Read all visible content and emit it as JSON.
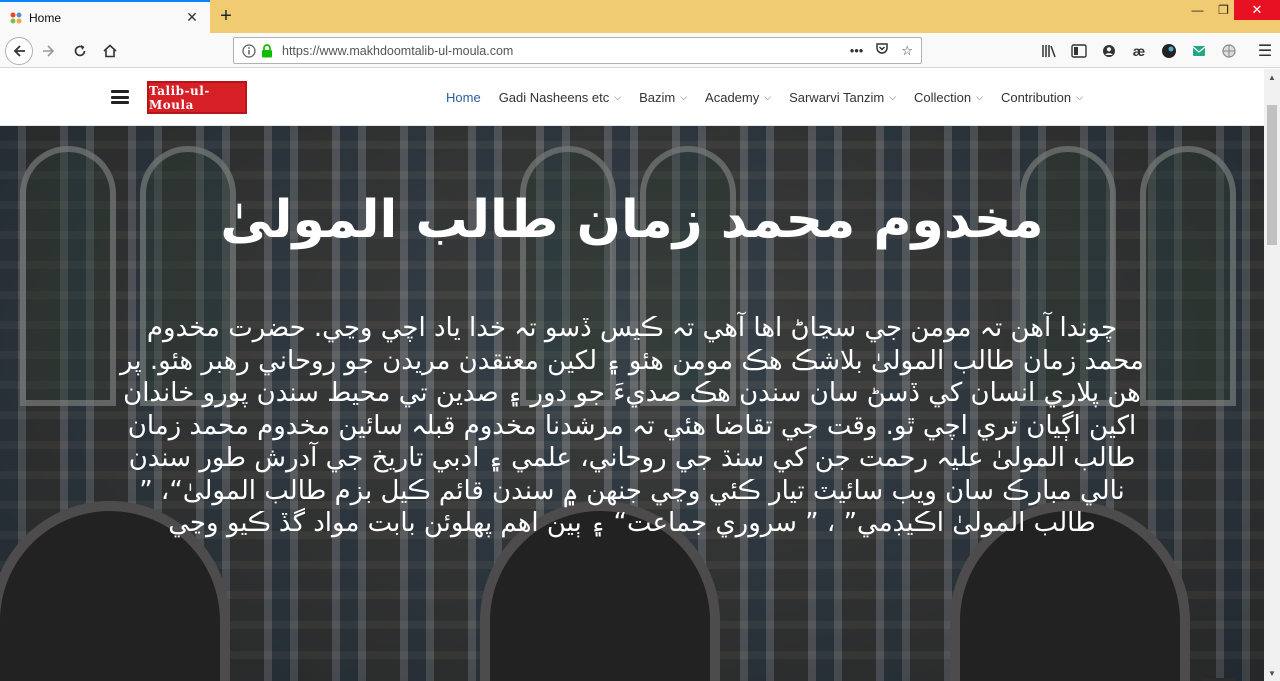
{
  "browser": {
    "tab_title": "Home",
    "url": "https://www.makhdoomtalib-ul-moula.com"
  },
  "site": {
    "logo_text": "Talib-ul-Moula",
    "menu": [
      {
        "label": "Home",
        "active": true
      },
      {
        "label": "Gadi Nasheens etc",
        "dropdown": true
      },
      {
        "label": "Bazim",
        "dropdown": true
      },
      {
        "label": "Academy",
        "dropdown": true
      },
      {
        "label": "Sarwarvi Tanzim",
        "dropdown": true
      },
      {
        "label": "Collection",
        "dropdown": true
      },
      {
        "label": "Contribution",
        "dropdown": true
      }
    ]
  },
  "hero": {
    "headline": "مخدوم محمد زمان طالب المولىٰ",
    "paragraph": "چوندا آهن تہ مومن جي سڃاڻ اها آهي تہ ڪيس ڏسو تہ خدا ياد اچي وڃي. حضرت مخدوم محمد زمان طالب المولىٰ بلاشڪ هڪ مومن هئو ۽ لکين معتقدن مريدن جو روحاني رهبر هئو. پر هن پلاري انسان کي ڏسڻ سان سندن هڪ صديءَ جو دور ۽ صدين تي محيط سندن پورو خاندان اکين اڳيان تري اچي ٿو. وقت جي تقاضا هئي تہ مرشدنا مخدوم قبلہ سائين مخدوم محمد زمان طالب المولىٰ عليہ رحمت جن کي سنڌ جي روحاني، علمي ۽ ادبي تاريخ جي آدرش طور سندن نالي مبارڪ سان ويب سائيٽ تيار ڪئي وڃي جنهن ۾ سندن قائم ڪيل بزم طالب المولىٰ“، ” طالب المولىٰ اڪيڊمي” ، ” سروري جماعت“ ۽ ٻين اهم پهلوئن بابت مواد گڏ ڪيو وڃي"
  },
  "colors": {
    "tabstrip": "#f0cb72",
    "logo_bg": "#d62026",
    "menu_active": "#2a5f9e"
  }
}
